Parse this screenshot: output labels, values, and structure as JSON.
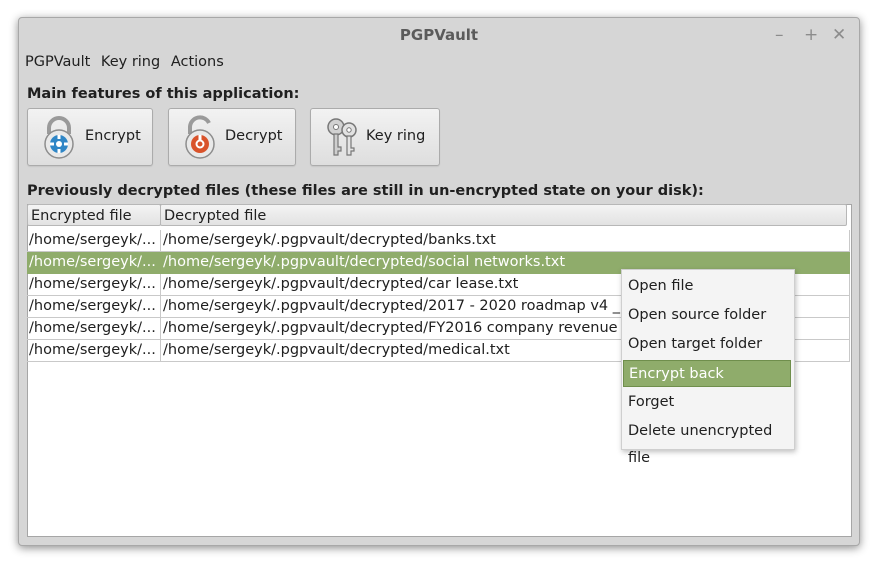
{
  "window": {
    "title": "PGPVault",
    "minimize": "–",
    "maximize": "+",
    "close": "✕"
  },
  "menubar": {
    "items": [
      "PGPVault",
      "Key ring",
      "Actions"
    ]
  },
  "features": {
    "heading": "Main features of this application:",
    "encrypt_label": "Encrypt",
    "decrypt_label": "Decrypt",
    "keyring_label": "Key ring",
    "colors": {
      "encrypt": "#2f86c6",
      "decrypt": "#d9532b",
      "selection": "#8fac6b"
    }
  },
  "files": {
    "heading": "Previously decrypted files (these files are still in un-encrypted state on your disk):",
    "columns": [
      "Encrypted file",
      "Decrypted file"
    ],
    "rows": [
      {
        "encrypted": "/home/sergeyk/...",
        "decrypted": "/home/sergeyk/.pgpvault/decrypted/banks.txt"
      },
      {
        "encrypted": "/home/sergeyk/...",
        "decrypted": "/home/sergeyk/.pgpvault/decrypted/social networks.txt"
      },
      {
        "encrypted": "/home/sergeyk/...",
        "decrypted": "/home/sergeyk/.pgpvault/decrypted/car lease.txt"
      },
      {
        "encrypted": "/home/sergeyk/...",
        "decrypted": "/home/sergeyk/.pgpvault/decrypted/2017 - 2020 roadmap v4 _SK"
      },
      {
        "encrypted": "/home/sergeyk/...",
        "decrypted": "/home/sergeyk/.pgpvault/decrypted/FY2016 company revenue re"
      },
      {
        "encrypted": "/home/sergeyk/...",
        "decrypted": "/home/sergeyk/.pgpvault/decrypted/medical.txt"
      }
    ],
    "selected_row": 2
  },
  "context_menu": {
    "items": [
      "Open file",
      "Open source folder",
      "Open target folder",
      "Encrypt back",
      "Forget",
      "Delete unencrypted file"
    ],
    "active": "Encrypt back"
  }
}
